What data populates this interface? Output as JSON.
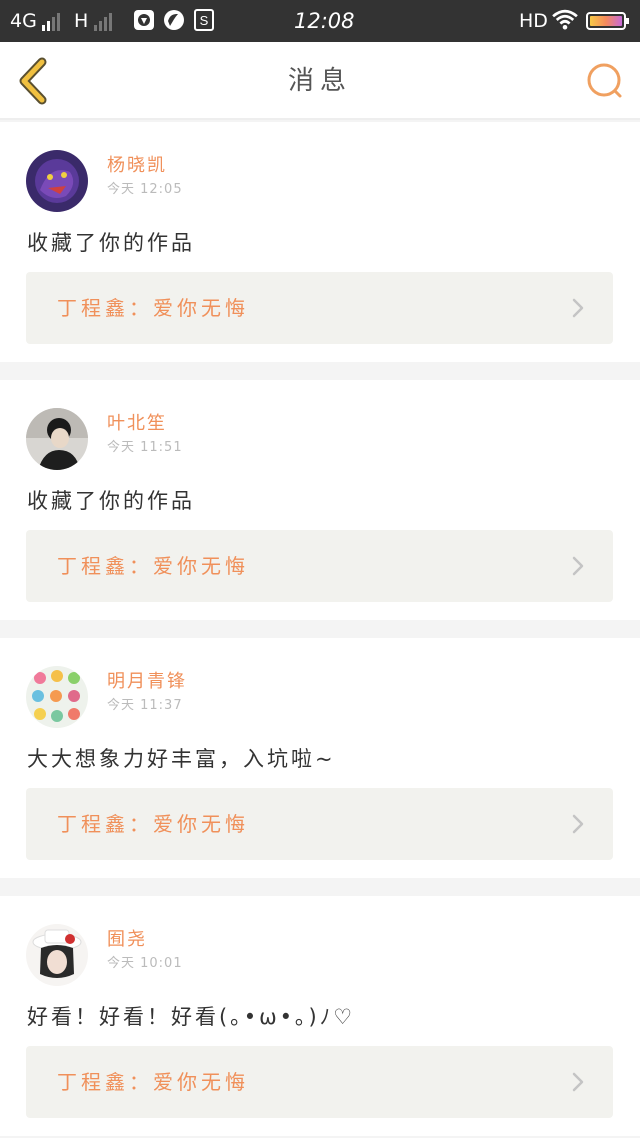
{
  "status_bar": {
    "network_1": "4G",
    "network_2": "H",
    "time": "12:08",
    "hd": "HD"
  },
  "header": {
    "title": "消息",
    "back_icon": "chevron-left-icon",
    "search_icon": "search-icon",
    "accent_color": "#f0a060"
  },
  "messages": [
    {
      "user": "杨晓凯",
      "time": "今天  12:05",
      "comment": "收藏了你的作品",
      "work": "丁程鑫：爱你无悔"
    },
    {
      "user": "叶北笙",
      "time": "今天  11:51",
      "comment": "收藏了你的作品",
      "work": "丁程鑫：爱你无悔"
    },
    {
      "user": "明月青锋",
      "time": "今天  11:37",
      "comment": "大大想象力好丰富，入坑啦~",
      "work": "丁程鑫：爱你无悔"
    },
    {
      "user": "囿尧",
      "time": "今天  10:01",
      "comment": "好看！好看！好看(｡•ω•｡)ﾉ♡",
      "work": "丁程鑫：爱你无悔"
    }
  ],
  "colors": {
    "name": "#f0905a",
    "work_bg": "#f2f2ee",
    "status_bg": "#333333"
  }
}
